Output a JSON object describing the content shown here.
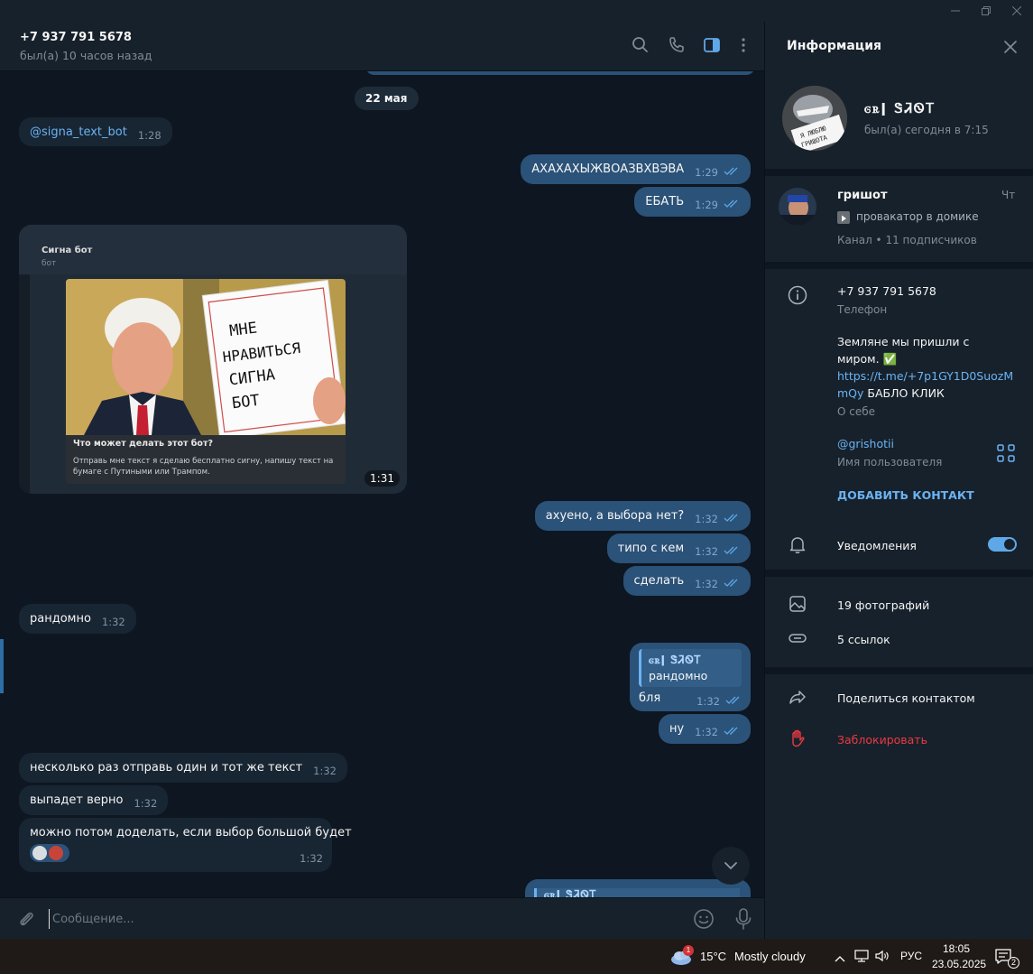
{
  "chat": {
    "name": "+7 937 791 5678",
    "status": "был(а) 10 часов назад",
    "date_separator": "22 мая",
    "messages": [
      {
        "text": "@signa_text_bot",
        "time": "1:28"
      },
      {
        "text": "АХАХАХЫЖВОАЗВХВЭВА",
        "time": "1:29"
      },
      {
        "text": "ЕБАТЬ",
        "time": "1:29"
      },
      {
        "text": "ахуено, а выбора нет?",
        "time": "1:32"
      },
      {
        "text": "типо с кем",
        "time": "1:32"
      },
      {
        "text": "сделать",
        "time": "1:32"
      },
      {
        "text": "рандомно",
        "time": "1:32"
      },
      {
        "quote_name": "ꮆꭱǀ ᏕᏘᏫᎢ",
        "quote_text": "рандомно",
        "text": "бля",
        "time": "1:32"
      },
      {
        "text": "ну",
        "time": "1:32"
      },
      {
        "text": "несколько раз отправь один и тот же текст",
        "time": "1:32"
      },
      {
        "text": "выпадет верно",
        "time": "1:32"
      },
      {
        "text": "можно потом доделать, если выбор большой будет",
        "time": "1:32"
      }
    ],
    "media": {
      "bot_name": "Сигна бот",
      "bot_sub": "бот",
      "sign_text": [
        "МНЕ",
        "НРАВИТЬСЯ",
        "СИГНА",
        "БОТ"
      ],
      "question": "Что может делать этот бот?",
      "description": "Отправь мне текст я сделаю бесплатно сигну, напишу текст на бумаге с Путиными или Трампом.",
      "time": "1:31"
    },
    "partial_quote_name": "ꮆꭱǀ ᏕᏘᏫᎢ",
    "composer_placeholder": "Сообщение..."
  },
  "panel": {
    "title": "Информация",
    "profile_name": "ꮆꭱǀ ᏕᏘᏫᎢ",
    "profile_status": "был(а) сегодня в 7:15",
    "avatar_sign_text": [
      "Я ЛЮБЛЮ",
      "ГРИШОТА"
    ],
    "channel": {
      "name": "гришот",
      "day": "Чт",
      "last_post": "провакатор в домике",
      "meta": "Канал • 11 подписчиков"
    },
    "phone": "+7 937 791 5678",
    "phone_label": "Телефон",
    "bio_line1": "Земляне мы пришли с",
    "bio_line2": "миром. ✅",
    "bio_link_1": "https://t.me/+7p1GY1D0SuozM",
    "bio_link_2": "mQy",
    "bio_tail": " БАБЛО КЛИК",
    "bio_label": "О себе",
    "username": "@grishotii",
    "username_label": "Имя пользователя",
    "add_contact": "ДОБАВИТЬ КОНТАКТ",
    "notifications": "Уведомления",
    "photos": "19 фотографий",
    "links": "5 ссылок",
    "share": "Поделиться контактом",
    "block": "Заблокировать"
  },
  "taskbar": {
    "weather_temp": "15°C",
    "weather_desc": "Mostly cloudy",
    "weather_badge": "1",
    "lang": "РУС",
    "time": "18:05",
    "date": "23.05.2025",
    "notif_count": "2"
  },
  "colors": {
    "accent": "#6ab3f3",
    "outgoing_bubble": "#2b5278",
    "incoming_bubble": "#182533",
    "danger": "#ec3942"
  }
}
